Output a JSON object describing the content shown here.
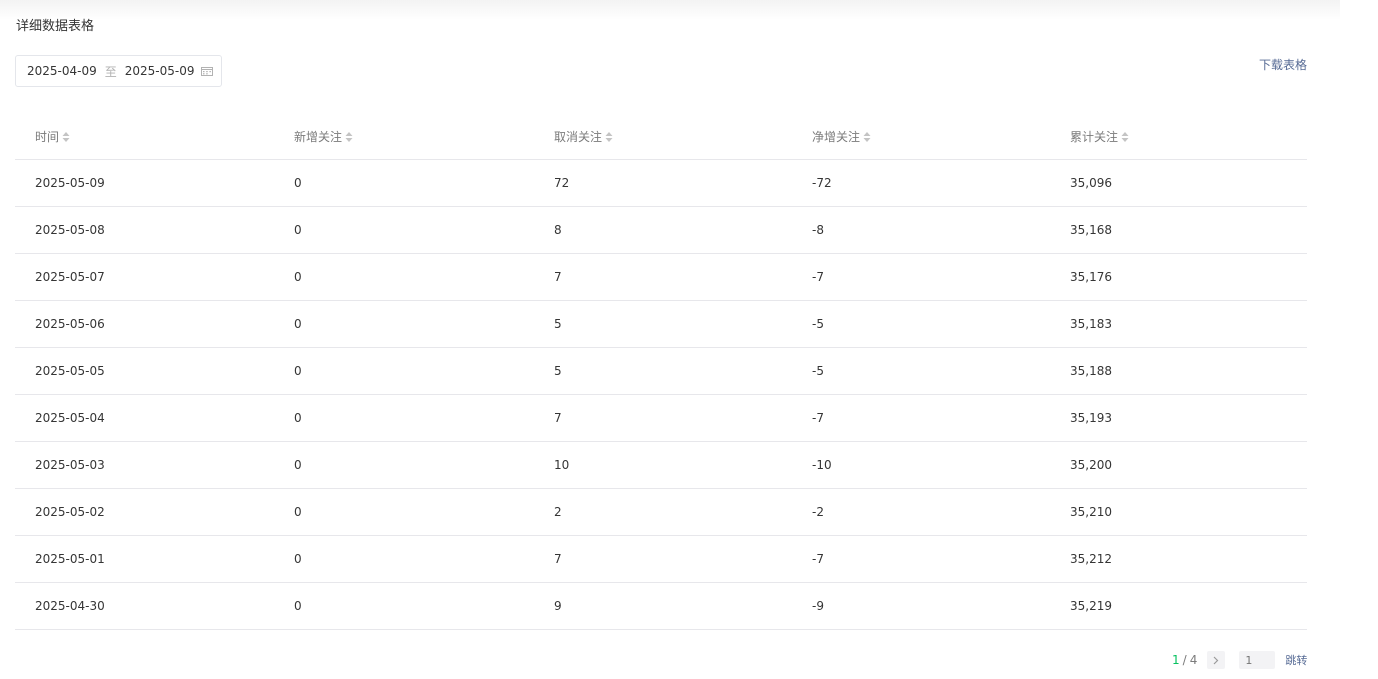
{
  "section_title": "详细数据表格",
  "date_range": {
    "start": "2025-04-09",
    "separator": "至",
    "end": "2025-05-09"
  },
  "download_label": "下载表格",
  "table": {
    "columns": [
      "时间",
      "新增关注",
      "取消关注",
      "净增关注",
      "累计关注"
    ],
    "rows": [
      [
        "2025-05-09",
        "0",
        "72",
        "-72",
        "35,096"
      ],
      [
        "2025-05-08",
        "0",
        "8",
        "-8",
        "35,168"
      ],
      [
        "2025-05-07",
        "0",
        "7",
        "-7",
        "35,176"
      ],
      [
        "2025-05-06",
        "0",
        "5",
        "-5",
        "35,183"
      ],
      [
        "2025-05-05",
        "0",
        "5",
        "-5",
        "35,188"
      ],
      [
        "2025-05-04",
        "0",
        "7",
        "-7",
        "35,193"
      ],
      [
        "2025-05-03",
        "0",
        "10",
        "-10",
        "35,200"
      ],
      [
        "2025-05-02",
        "0",
        "2",
        "-2",
        "35,210"
      ],
      [
        "2025-05-01",
        "0",
        "7",
        "-7",
        "35,212"
      ],
      [
        "2025-04-30",
        "0",
        "9",
        "-9",
        "35,219"
      ]
    ]
  },
  "pagination": {
    "current": "1",
    "separator": "/",
    "total": "4",
    "input_placeholder": "1",
    "jump_label": "跳转"
  },
  "colors": {
    "accent_green": "#07c160",
    "link_blue": "#576b95",
    "border": "#e7e7eb"
  },
  "icons": {
    "calendar": "calendar-icon",
    "sort": "sort-icon",
    "next": "chevron-right-icon"
  }
}
